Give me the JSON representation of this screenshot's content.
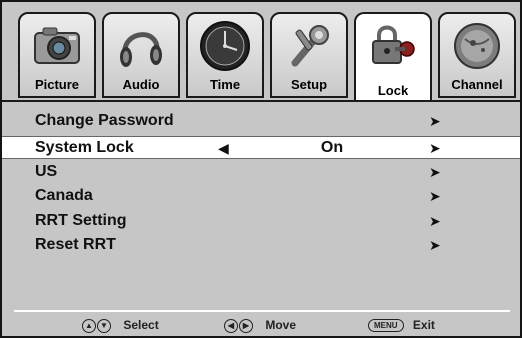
{
  "tabs": [
    {
      "label": "Picture",
      "icon": "camera-icon",
      "active": false
    },
    {
      "label": "Audio",
      "icon": "headphones-icon",
      "active": false
    },
    {
      "label": "Time",
      "icon": "clock-icon",
      "active": false
    },
    {
      "label": "Setup",
      "icon": "tools-icon",
      "active": false
    },
    {
      "label": "Lock",
      "icon": "lock-key-icon",
      "active": true
    },
    {
      "label": "Channel",
      "icon": "satellite-dish-icon",
      "active": false
    }
  ],
  "menu": [
    {
      "label": "Change Password",
      "value": "",
      "selected": false
    },
    {
      "label": "System Lock",
      "value": "On",
      "selected": true
    },
    {
      "label": "US",
      "value": "",
      "selected": false
    },
    {
      "label": "Canada",
      "value": "",
      "selected": false
    },
    {
      "label": "RRT Setting",
      "value": "",
      "selected": false
    },
    {
      "label": "Reset RRT",
      "value": "",
      "selected": false
    }
  ],
  "glyphs": {
    "right_arrow": "➤",
    "left_arrow": "◀"
  },
  "footer": {
    "select_label": "Select",
    "move_label": "Move",
    "menu_key": "MENU",
    "exit_label": "Exit"
  },
  "colors": {
    "background": "#c6c6c6",
    "highlight": "#ffffff",
    "border": "#151515"
  }
}
